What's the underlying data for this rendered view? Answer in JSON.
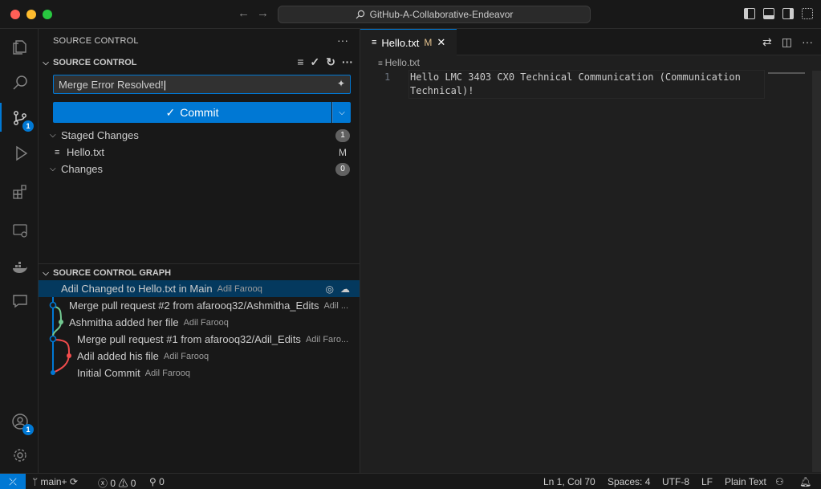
{
  "window": {
    "title": "GitHub-A-Collaborative-Endeavor"
  },
  "sidebar": {
    "title": "SOURCE CONTROL",
    "section_title": "SOURCE CONTROL",
    "commit_message": "Merge Error Resolved!",
    "commit_label": "Commit",
    "staged_label": "Staged Changes",
    "staged_count": "1",
    "staged_files": [
      {
        "name": "Hello.txt",
        "status": "M"
      }
    ],
    "changes_label": "Changes",
    "changes_count": "0",
    "graph_title": "SOURCE CONTROL GRAPH",
    "graph": [
      {
        "message": "Adil Changed to Hello.txt in Main",
        "author": "Adil Farooq"
      },
      {
        "message": "Merge pull request #2 from afarooq32/Ashmitha_Edits",
        "author": "Adil ..."
      },
      {
        "message": "Ashmitha added her file",
        "author": "Adil Farooq"
      },
      {
        "message": "Merge pull request #1 from afarooq32/Adil_Edits",
        "author": "Adil Faro..."
      },
      {
        "message": "Adil added his file",
        "author": "Adil Farooq"
      },
      {
        "message": "Initial Commit",
        "author": "Adil Farooq"
      }
    ]
  },
  "activity": {
    "scm_badge": "1",
    "account_badge": "1"
  },
  "editor": {
    "tab_label": "Hello.txt",
    "tab_status": "M",
    "breadcrumb": "Hello.txt",
    "lines": [
      {
        "number": "1",
        "text": "Hello LMC 3403 CX0 Technical Communication (Communication",
        "cont": "Technical)!"
      }
    ]
  },
  "statusbar": {
    "branch": "main+",
    "errors": "0",
    "warnings": "0",
    "ports": "0",
    "position": "Ln 1, Col 70",
    "spaces": "Spaces: 4",
    "encoding": "UTF-8",
    "eol": "LF",
    "language": "Plain Text"
  },
  "colors": {
    "accent": "#0078d4",
    "git_green": "#73c991",
    "git_red": "#f14c4c"
  }
}
